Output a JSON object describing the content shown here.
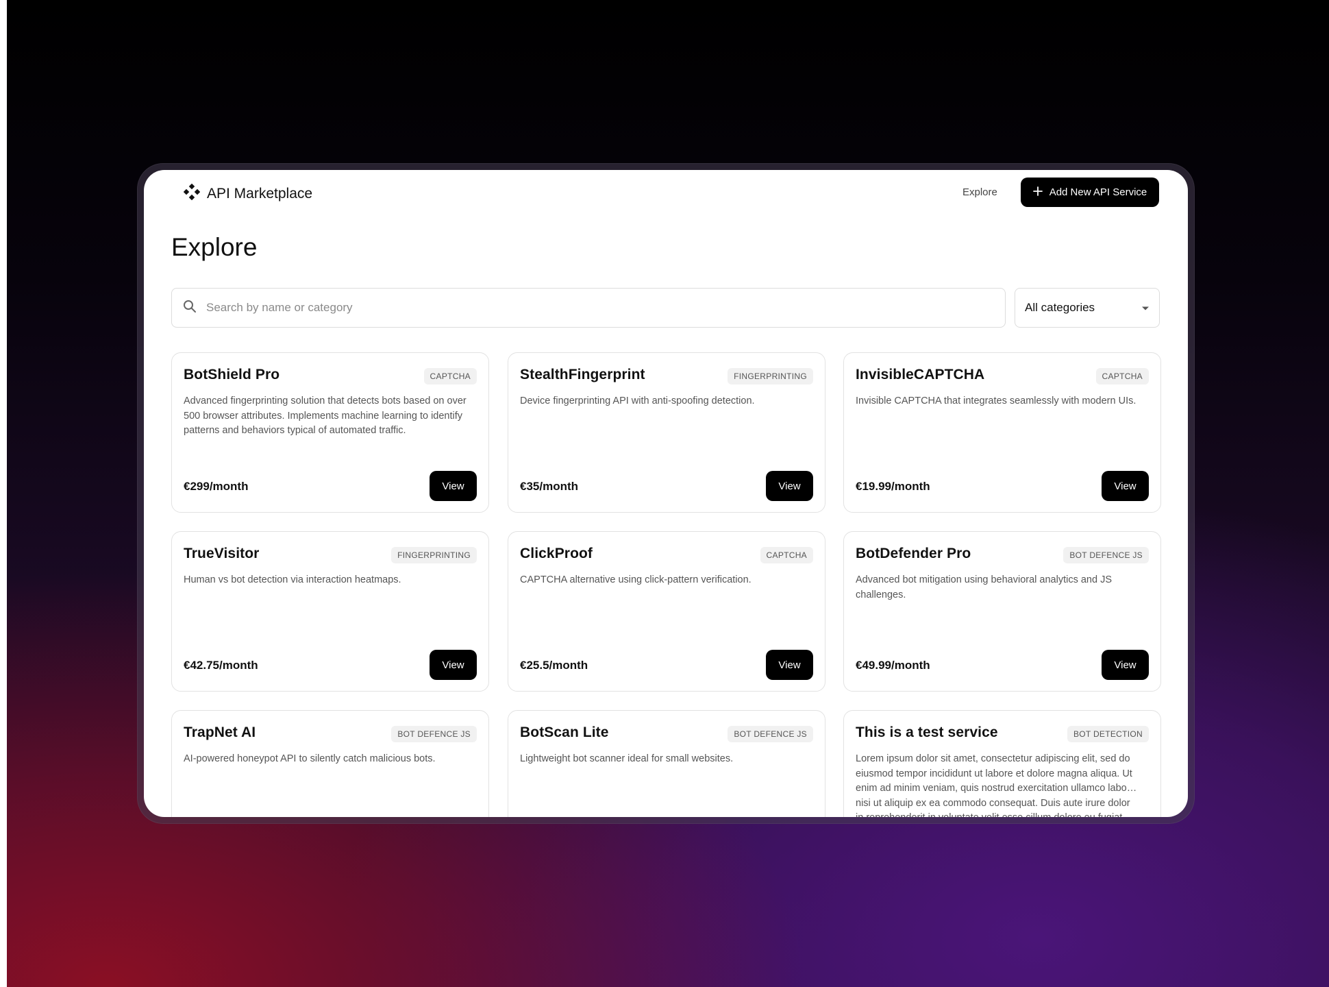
{
  "header": {
    "brand": "API Marketplace",
    "nav_explore": "Explore",
    "add_button": "Add New API Service",
    "brand_icon": "diamond-cluster-icon",
    "add_icon": "plus-icon"
  },
  "page": {
    "title": "Explore"
  },
  "search": {
    "placeholder": "Search by name or category",
    "value": "",
    "icon": "search-icon"
  },
  "filter": {
    "selected": "All categories",
    "icon": "caret-down-icon"
  },
  "colors": {
    "accent": "#000000",
    "badge_bg": "#f1f1f1",
    "border": "#e2e2e2"
  },
  "cards": [
    {
      "name": "BotShield Pro",
      "category": "CAPTCHA",
      "description": "Advanced fingerprinting solution that detects bots based on over 500 browser attributes. Implements machine learning to identify patterns and behaviors typical of automated traffic.",
      "price": "€299/month",
      "button": "View"
    },
    {
      "name": "StealthFingerprint",
      "category": "FINGERPRINTING",
      "description": "Device fingerprinting API with anti-spoofing detection.",
      "price": "€35/month",
      "button": "View"
    },
    {
      "name": "InvisibleCAPTCHA",
      "category": "CAPTCHA",
      "description": "Invisible CAPTCHA that integrates seamlessly with modern UIs.",
      "price": "€19.99/month",
      "button": "View"
    },
    {
      "name": "TrueVisitor",
      "category": "FINGERPRINTING",
      "description": "Human vs bot detection via interaction heatmaps.",
      "price": "€42.75/month",
      "button": "View"
    },
    {
      "name": "ClickProof",
      "category": "CAPTCHA",
      "description": "CAPTCHA alternative using click-pattern verification.",
      "price": "€25.5/month",
      "button": "View"
    },
    {
      "name": "BotDefender Pro",
      "category": "BOT DEFENCE JS",
      "description": "Advanced bot mitigation using behavioral analytics and JS challenges.",
      "price": "€49.99/month",
      "button": "View"
    },
    {
      "name": "TrapNet AI",
      "category": "BOT DEFENCE JS",
      "description": "AI-powered honeypot API to silently catch malicious bots.",
      "price": "",
      "button": ""
    },
    {
      "name": "BotScan Lite",
      "category": "BOT DEFENCE JS",
      "description": "Lightweight bot scanner ideal for small websites.",
      "price": "",
      "button": ""
    },
    {
      "name": "This is a test service",
      "category": "BOT DETECTION",
      "description_lines": [
        "Lorem ipsum dolor sit amet, consectetur adipiscing elit, sed do",
        "eiusmod tempor incididunt ut labore et dolore magna aliqua. Ut",
        "enim ad minim veniam, quis nostrud exercitation ullamco labo…",
        "nisi ut aliquip ex ea commodo consequat. Duis aute irure dolor",
        "in reprehenderit in voluptate velit esse cillum dolore eu fugiat"
      ],
      "price": "",
      "button": ""
    }
  ]
}
